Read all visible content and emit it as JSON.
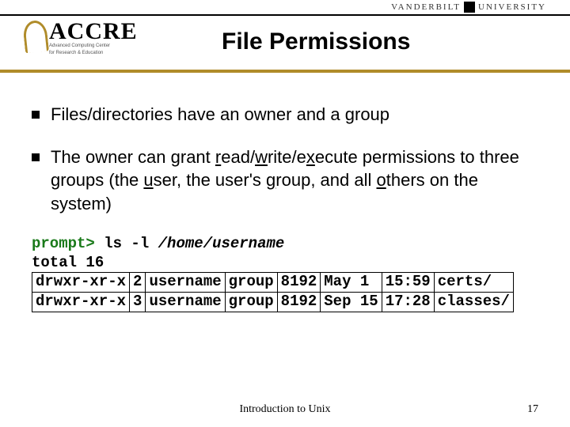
{
  "uni_logo": {
    "left": "VANDERBILT",
    "right": "UNIVERSITY"
  },
  "accre_logo": {
    "main": "ACCRE",
    "sub1": "Advanced Computing Center",
    "sub2": "for Research & Education"
  },
  "title": "File Permissions",
  "bullets": [
    {
      "text": "Files/directories have an owner and a group"
    },
    {
      "parts": [
        "The owner can grant ",
        "r",
        "ead/",
        "w",
        "rite/e",
        "x",
        "ecute permissions to three groups (the ",
        "u",
        "ser, the user's ",
        "g",
        "roup, and all ",
        "o",
        "thers on the system)"
      ]
    }
  ],
  "code": {
    "prompt": "prompt>",
    "cmd": " ls -l ",
    "arg": "/home/username",
    "total": "total 16",
    "rows": [
      [
        "drwxr-xr-x",
        "2",
        "username",
        "group",
        "8192",
        "May  1",
        "15:59",
        "certs/"
      ],
      [
        "drwxr-xr-x",
        "3",
        "username",
        "group",
        "8192",
        "Sep 15",
        "17:28",
        "classes/"
      ]
    ]
  },
  "footer": {
    "center": "Introduction to Unix",
    "page": "17"
  }
}
